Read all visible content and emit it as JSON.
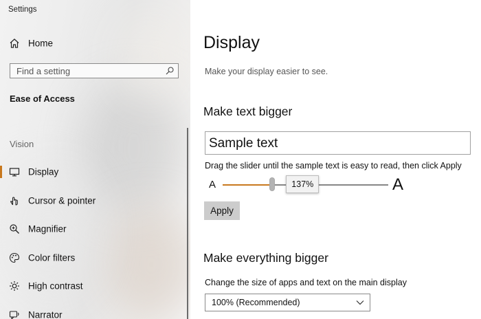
{
  "window": {
    "title": "Settings"
  },
  "sidebar": {
    "home_label": "Home",
    "search_placeholder": "Find a setting",
    "section_title": "Ease of Access",
    "group_label": "Vision",
    "items": [
      {
        "label": "Display",
        "icon": "monitor-icon"
      },
      {
        "label": "Cursor & pointer",
        "icon": "cursor-pointer-icon"
      },
      {
        "label": "Magnifier",
        "icon": "magnifier-icon"
      },
      {
        "label": "Color filters",
        "icon": "color-filters-icon"
      },
      {
        "label": "High contrast",
        "icon": "high-contrast-icon"
      },
      {
        "label": "Narrator",
        "icon": "narrator-icon"
      }
    ]
  },
  "main": {
    "title": "Display",
    "subtitle": "Make your display easier to see.",
    "text_section": {
      "heading": "Make text bigger",
      "sample_text": "Sample text",
      "instructions": "Drag the slider until the sample text is easy to read, then click Apply",
      "small_a": "A",
      "large_a": "A",
      "slider_value": "137%",
      "slider_fraction": 0.3,
      "apply_label": "Apply"
    },
    "everything_section": {
      "heading": "Make everything bigger",
      "description": "Change the size of apps and text on the main display",
      "selected": "100% (Recommended)"
    }
  },
  "colors": {
    "accent": "#c8781e"
  }
}
